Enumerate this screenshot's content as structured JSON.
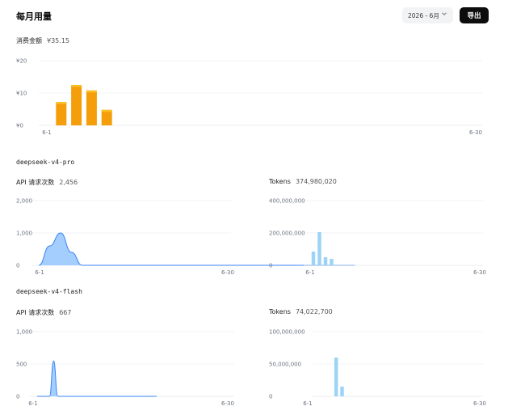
{
  "header": {
    "title": "每月用量",
    "period": "2026 - 6月",
    "export_label": "导出",
    "chevron_icon": "chevron-down-icon"
  },
  "spend": {
    "label": "消费金额",
    "total": "¥35.15"
  },
  "models": [
    {
      "name": "deepseek-v4-pro",
      "requests_label": "API 请求次数",
      "requests_total": "2,456",
      "tokens_label": "Tokens",
      "tokens_total": "374,980,020"
    },
    {
      "name": "deepseek-v4-flash",
      "requests_label": "API 请求次数",
      "requests_total": "667",
      "tokens_label": "Tokens",
      "tokens_total": "74,022,700"
    }
  ],
  "colors": {
    "spend_bar": "#f59e0b",
    "spend_bar_top": "#fbbf24",
    "area_fill": "#93c5fd",
    "area_line": "#3b82f6",
    "token_bar": "#9dd3f5",
    "grid": "#e5e7eb"
  },
  "chart_data": [
    {
      "id": "spend",
      "type": "bar",
      "x": [
        1,
        2,
        3,
        4,
        5,
        6,
        7,
        8,
        9,
        10,
        11,
        12,
        13,
        14,
        15,
        16,
        17,
        18,
        19,
        20,
        21,
        22,
        23,
        24,
        25,
        26,
        27,
        28,
        29,
        30
      ],
      "values": [
        0,
        7.2,
        12.5,
        10.8,
        4.8,
        0,
        0,
        0,
        0,
        0,
        0,
        0,
        0,
        0,
        0,
        0,
        0,
        0,
        0,
        0,
        0,
        0,
        0,
        0,
        0,
        0,
        0,
        0,
        0,
        0
      ],
      "ylim": [
        0,
        20
      ],
      "yticks": [
        "¥0",
        "¥10",
        "¥20"
      ],
      "xticks": [
        "6-1",
        "6-30"
      ]
    },
    {
      "id": "pro_requests",
      "type": "area",
      "x": [
        1,
        2,
        3,
        4,
        5,
        6,
        7,
        8,
        9,
        10,
        11,
        12,
        13,
        14,
        15,
        16,
        17,
        18,
        19,
        20,
        21,
        22,
        23,
        24,
        25,
        26,
        27,
        28,
        29,
        30
      ],
      "values": [
        0,
        600,
        1000,
        400,
        0,
        0,
        0,
        0,
        0,
        0,
        0,
        0,
        0,
        0,
        0,
        0,
        0,
        0,
        0,
        0,
        0,
        0,
        0,
        0,
        0,
        0,
        0,
        0,
        0,
        0
      ],
      "ylim": [
        0,
        2000
      ],
      "yticks": [
        "0",
        "1,000",
        "2,000"
      ],
      "xticks": [
        "6-1",
        "6-30"
      ]
    },
    {
      "id": "pro_tokens",
      "type": "bar",
      "x": [
        1,
        2,
        3,
        4,
        5,
        6,
        7,
        8,
        9,
        10,
        11,
        12,
        13,
        14,
        15,
        16,
        17,
        18,
        19,
        20,
        21,
        22,
        23,
        24,
        25,
        26,
        27,
        28,
        29,
        30
      ],
      "values": [
        0,
        0,
        85000000,
        205000000,
        50000000,
        40000000,
        0,
        0,
        0,
        0,
        0,
        0,
        0,
        0,
        0,
        0,
        0,
        0,
        0,
        0,
        0,
        0,
        0,
        0,
        0,
        0,
        0,
        0,
        0,
        0
      ],
      "ylim": [
        0,
        400000000
      ],
      "yticks": [
        "0",
        "200,000,000",
        "400,000,000"
      ],
      "xticks": [
        "6-1",
        "6-30"
      ]
    },
    {
      "id": "flash_requests",
      "type": "area",
      "x": [
        1,
        2,
        3,
        4,
        5,
        6,
        7,
        8,
        9,
        10,
        11,
        12,
        13,
        14,
        15,
        16,
        17,
        18,
        19,
        20,
        21,
        22,
        23,
        24,
        25,
        26,
        27,
        28,
        29,
        30
      ],
      "values": [
        0,
        0,
        0,
        0,
        550,
        0,
        0,
        0,
        0,
        0,
        0,
        0,
        0,
        0,
        0,
        0,
        0,
        0,
        0,
        0,
        0,
        0,
        0,
        0,
        0,
        0,
        0,
        0,
        0,
        0
      ],
      "ylim": [
        0,
        1000
      ],
      "yticks": [
        "0",
        "500",
        "1,000"
      ],
      "xticks": [
        "6-1",
        "6-30"
      ]
    },
    {
      "id": "flash_tokens",
      "type": "bar",
      "x": [
        1,
        2,
        3,
        4,
        5,
        6,
        7,
        8,
        9,
        10,
        11,
        12,
        13,
        14,
        15,
        16,
        17,
        18,
        19,
        20,
        21,
        22,
        23,
        24,
        25,
        26,
        27,
        28,
        29,
        30
      ],
      "values": [
        0,
        0,
        0,
        0,
        60000000,
        15000000,
        0,
        0,
        0,
        0,
        0,
        0,
        0,
        0,
        0,
        0,
        0,
        0,
        0,
        0,
        0,
        0,
        0,
        0,
        0,
        0,
        0,
        0,
        0,
        0
      ],
      "ylim": [
        0,
        100000000
      ],
      "yticks": [
        "0",
        "50,000,000",
        "100,000,000"
      ],
      "xticks": [
        "6-1",
        "6-30"
      ]
    }
  ]
}
